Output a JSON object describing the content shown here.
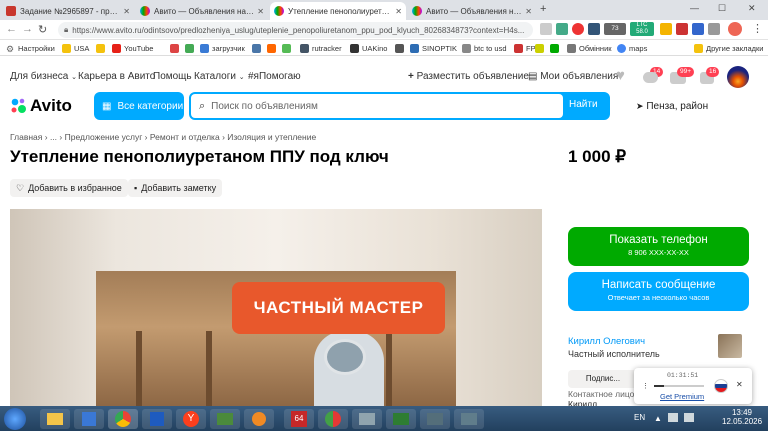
{
  "browser": {
    "tabs": [
      {
        "title": "Задание №2965897 - просмотр з...",
        "active": false
      },
      {
        "title": "Авито — Объявления на сайте А...",
        "active": false
      },
      {
        "title": "Утепление пенополиуретаном П...",
        "active": true
      },
      {
        "title": "Авито — Объявления на сайте А...",
        "active": false
      }
    ],
    "url": "https://www.avito.ru/odintsovo/predlozheniya_uslug/uteplenie_penopoliuretanom_ppu_pod_klyuch_8026834873?context=H4s...",
    "ext_ltc": "LTC",
    "ext_num1": "73",
    "ext_num2": "58.0",
    "bookmarks": [
      "Настройки",
      "USA",
      "YouTube",
      "загрузчик",
      "rutracker",
      "UAKino",
      "SINOPTIK",
      "btc to usd",
      "FP",
      "Обмінник",
      "maps",
      "Другие закладки"
    ]
  },
  "header": {
    "links": [
      "Для бизнеса",
      "Карьера в Авито",
      "Помощь",
      "Каталоги",
      "#яПомогаю"
    ],
    "post_ad": "Разместить объявление",
    "my_ads": "Мои объявления",
    "badge_fav": "14",
    "badge_msg": "99+",
    "badge_cart": "16"
  },
  "search": {
    "logo": "Avito",
    "categories": "Все категории",
    "placeholder": "Поиск по объявлениям",
    "button": "Найти",
    "location": "Пенза, район"
  },
  "breadcrumbs": [
    "Главная",
    "...",
    "Предложение услуг",
    "Ремонт и отделка",
    "Изоляция и утепление"
  ],
  "listing": {
    "title": "Утепление пенополиуретаном ППУ под ключ",
    "price": "1 000 ₽",
    "fav_button": "Добавить в избранное",
    "note_button": "Добавить заметку",
    "banner_text": "ЧАСТНЫЙ МАСТЕР"
  },
  "actions": {
    "phone_label": "Показать телефон",
    "phone_number": "8 906 XXX-XX-XX",
    "message_label": "Написать сообщение",
    "message_sub": "Отвечает за несколько часов"
  },
  "seller": {
    "name": "Кирилл Олегович",
    "type": "Частный исполнитель",
    "btn_partial": "Подпис...",
    "contact_label": "Контактное лицо",
    "contact_name": "Кирилл"
  },
  "popup": {
    "time": "01:31:51",
    "link": "Get Premium"
  },
  "taskbar": {
    "lang": "EN",
    "time": "13:49",
    "date": "12.05.2026"
  },
  "colors": {
    "green": "#00aa00",
    "blue": "#00aaff",
    "accent_orange": "#e8582c"
  }
}
